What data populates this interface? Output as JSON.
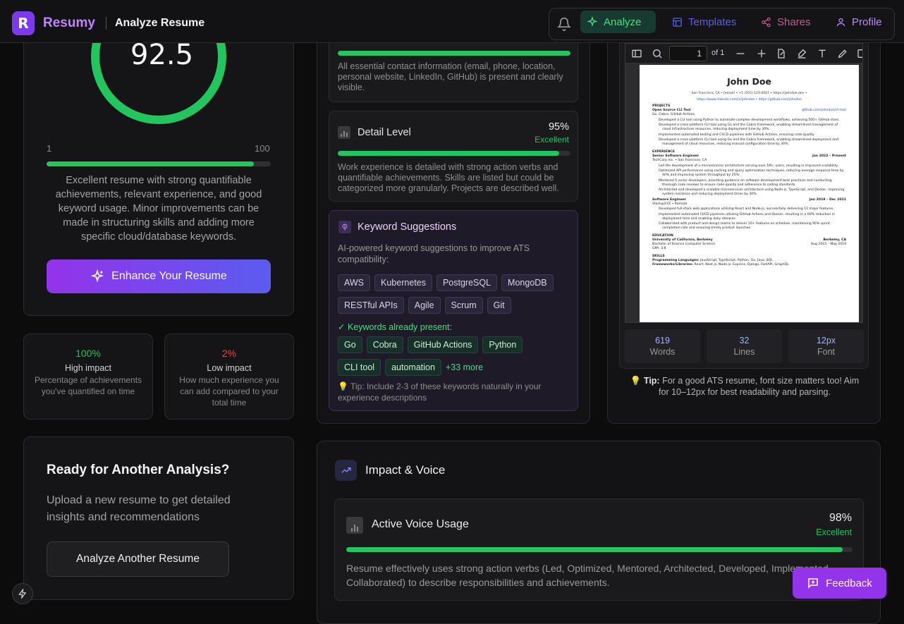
{
  "header": {
    "logo_letter": "R",
    "brand": "Resumy",
    "page_title": "Analyze Resume"
  },
  "nav": {
    "analyze": "Analyze",
    "templates": "Templates",
    "shares": "Shares",
    "profile": "Profile"
  },
  "score": {
    "value": "92.5",
    "fraction": 0.925,
    "min": "1",
    "max": "100",
    "summary": "Excellent resume with strong quantifiable achievements, relevant experience, and good keyword usage. Minor improvements can be made in structuring skills and adding more specific cloud/database keywords.",
    "enhance": "Enhance Your Resume"
  },
  "stats": [
    {
      "value": "100%",
      "title": "High impact",
      "desc": "Percentage of achievements you've quantified on time",
      "color": "#22c55e"
    },
    {
      "value": "2%",
      "title": "Low impact",
      "desc": "How much experience you can add compared to your total time",
      "color": "#ef4444"
    }
  ],
  "another": {
    "title": "Ready for Another Analysis?",
    "desc": "Upload a new resume to get detailed insights and recommendations",
    "button": "Analyze Another Resume"
  },
  "contact": {
    "desc": "All essential contact information (email, phone, location, personal website, LinkedIn, GitHub) is present and clearly visible.",
    "fraction": 1
  },
  "detail": {
    "title": "Detail Level",
    "pct": "95%",
    "rating": "Excellent",
    "fraction": 0.95,
    "desc": "Work experience is detailed with strong action verbs and quantifiable achievements. Skills are listed but could be categorized more granularly. Projects are described well."
  },
  "keywords": {
    "title": "Keyword Suggestions",
    "desc": "AI-powered keyword suggestions to improve ATS compatibility:",
    "suggested": [
      "AWS",
      "Kubernetes",
      "PostgreSQL",
      "MongoDB",
      "RESTful APIs",
      "Agile",
      "Scrum",
      "Git"
    ],
    "present_label": "✓ Keywords already present:",
    "present": [
      "Go",
      "Cobra",
      "GitHub Actions",
      "Python",
      "CLI tool",
      "automation"
    ],
    "more": "+33 more",
    "tip": "💡 Tip: Include 2-3 of these keywords naturally in your experience descriptions"
  },
  "pdf": {
    "page": "1",
    "of": "of 1",
    "name": "John Doe",
    "contact1": "San Francisco, CA  •  [email]  •  +1 (555) 123-4567  •  https://johndoe.dev  •",
    "contact2": "https://www.linkedin.com/in/johndoe  •  https://github.com/johndoe",
    "sec_projects": "PROJECTS",
    "proj_title": "Open Source CLI Tool",
    "proj_link": "github.com/johndoe/cli-tool",
    "proj_sub": "Go, Cobra, GitHub Actions",
    "proj_bullets": [
      "Developed a CLI tool using Python to automate complex development workflows, achieving 500+ GitHub stars.",
      "Developed a cross-platform CLI tool using Go and the Cobra framework, enabling streamlined management of cloud infrastructure resources, reducing deployment time by 30%.",
      "Implemented automated testing and CI/CD pipelines with GitHub Actions, ensuring code quality.",
      "Developed a cross-platform CLI tool using Go and the Cobra framework, enabling streamlined deployment and management of cloud resources, reducing manual configuration time by 30%."
    ],
    "sec_exp": "EXPERIENCE",
    "job1_title": "Senior Software Engineer",
    "job1_date": "Jan 2022 – Present",
    "job1_sub": "TechCorp Inc.  •  San Francisco, CA",
    "job1_bullets": [
      "Led the development of a microservices architecture serving over 1M+ users, resulting in improved scalability.",
      "Optimized API performance using caching and query optimization techniques, reducing average response time by 40% and improving system throughput by 25%.",
      "Mentored 5 junior developers, providing guidance on software development best practices and conducting thorough code reviews to ensure code quality and adherence to coding standards.",
      "Architected and developed a scalable microservices architecture using Node.js, TypeScript, and Docker, improving system resilience and reducing deployment times by 30%."
    ],
    "job2_title": "Software Engineer",
    "job2_date": "Jun 2019 – Dec 2021",
    "job2_sub": "StartupXYZ  •  Remote",
    "job2_bullets": [
      "Developed full-stack web applications utilizing React and Node.js, successfully delivering 12 major features.",
      "Implemented automated CI/CD pipelines utilizing GitHub Actions and Docker, resulting in a 60% reduction in deployment time and enabling daily releases.",
      "Collaborated with product and design teams to deliver 10+ features on schedule, maintaining 95% sprint completion rate and ensuring timely product launches."
    ],
    "sec_edu": "EDUCATION",
    "edu_school": "University of California, Berkeley",
    "edu_loc": "Berkeley, CA",
    "edu_deg": "Bachelor of Science Computer Science",
    "edu_date": "Aug 2015 – May 2019",
    "edu_gpa": "GPA: 3.8",
    "sec_skills": "SKILLS",
    "skills1_label": "Programming Languages:",
    "skills1": "JavaScript, TypeScript, Python, Go, Java, SQL",
    "skills2_label": "Frameworks/Libraries:",
    "skills2": "React, Next.js, Node.js, Express, Django, FastAPI, GraphQL"
  },
  "docstats": [
    {
      "value": "619",
      "label": "Words"
    },
    {
      "value": "32",
      "label": "Lines"
    },
    {
      "value": "12px",
      "label": "Font"
    }
  ],
  "tip": {
    "label": "Tip:",
    "text": "For a good ATS resume, font size matters too! Aim for 10–12px for best readability and parsing."
  },
  "impact": {
    "title": "Impact & Voice",
    "metric_title": "Active Voice Usage",
    "pct": "98%",
    "rating": "Excellent",
    "fraction": 0.98,
    "desc": "Resume effectively uses strong action verbs (Led, Optimized, Mentored, Architected, Developed, Implemented, Collaborated) to describe responsibilities and achievements."
  },
  "feedback": "Feedback",
  "colors": {
    "accent": "#9333ea",
    "good": "#22c55e"
  }
}
